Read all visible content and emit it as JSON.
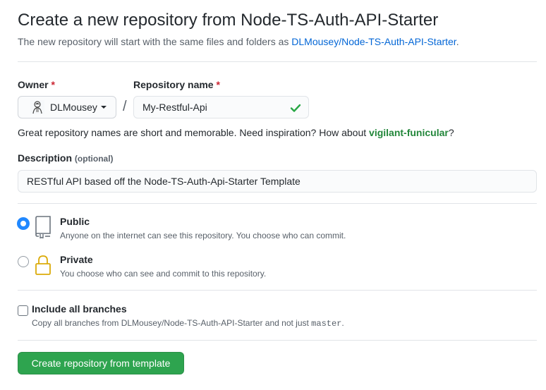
{
  "header": {
    "title": "Create a new repository from Node-TS-Auth-API-Starter",
    "subtitle_prefix": "The new repository will start with the same files and folders as ",
    "template_link": "DLMousey/Node-TS-Auth-API-Starter",
    "subtitle_suffix": "."
  },
  "owner": {
    "label": "Owner",
    "required_mark": "*",
    "value": "DLMousey"
  },
  "separator": "/",
  "repo_name": {
    "label": "Repository name",
    "required_mark": "*",
    "value": "My-Restful-Api"
  },
  "name_hint": {
    "text": "Great repository names are short and memorable. Need inspiration? How about ",
    "suggestion": "vigilant-funicular",
    "suffix": "?"
  },
  "description": {
    "label": "Description",
    "optional": "(optional)",
    "value": "RESTful API based off the Node-TS-Auth-Api-Starter Template"
  },
  "visibility": {
    "public": {
      "title": "Public",
      "note": "Anyone on the internet can see this repository. You choose who can commit.",
      "selected": true
    },
    "private": {
      "title": "Private",
      "note": "You choose who can see and commit to this repository.",
      "selected": false
    }
  },
  "branches": {
    "label": "Include all branches",
    "note_prefix": "Copy all branches from DLMousey/Node-TS-Auth-API-Starter and not just ",
    "note_code": "master",
    "note_suffix": ".",
    "checked": false
  },
  "submit": {
    "label": "Create repository from template"
  },
  "colors": {
    "link": "#0366d6",
    "success": "#2ea44f",
    "suggestion": "#22863a",
    "required": "#cb2431",
    "radio_selected": "#2188ff"
  }
}
